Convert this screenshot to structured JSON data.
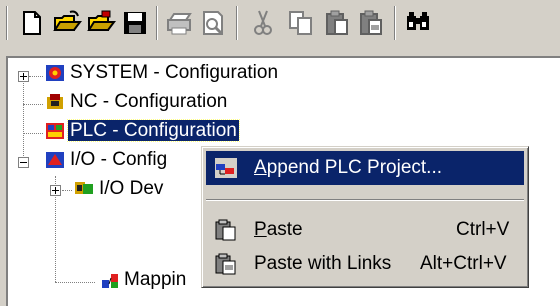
{
  "toolbar": {
    "buttons": [
      "new-file-icon",
      "open-icon",
      "open-folder-icon",
      "save-icon",
      "print-icon",
      "print-preview-icon",
      "cut-icon",
      "copy-icon",
      "paste-icon",
      "paste-with-links-icon",
      "find-icon"
    ]
  },
  "tree": {
    "items": [
      {
        "label": "SYSTEM - Configuration",
        "expander": "+"
      },
      {
        "label": "NC - Configuration"
      },
      {
        "label": "PLC - Configuration",
        "selected": true
      },
      {
        "label": "I/O - Configuration",
        "visible_label": "I/O - Config",
        "expander": "-"
      },
      {
        "label": "I/O Dev",
        "expander": "+"
      },
      {
        "label": "Mappin"
      }
    ]
  },
  "context_menu": {
    "items": [
      {
        "label": "Append PLC Project...",
        "mnemonic": "A",
        "highlighted": true,
        "icon": "plc-project-icon"
      },
      {
        "label": "Paste",
        "mnemonic": "P",
        "accelerator": "Ctrl+V",
        "icon": "paste-icon"
      },
      {
        "label": "Paste with Links",
        "accelerator": "Alt+Ctrl+V",
        "icon": "paste-with-links-icon"
      }
    ]
  },
  "colors": {
    "selection": "#0a246a",
    "face": "#d4d0c8",
    "shadow": "#808080",
    "window": "#ffffff"
  }
}
